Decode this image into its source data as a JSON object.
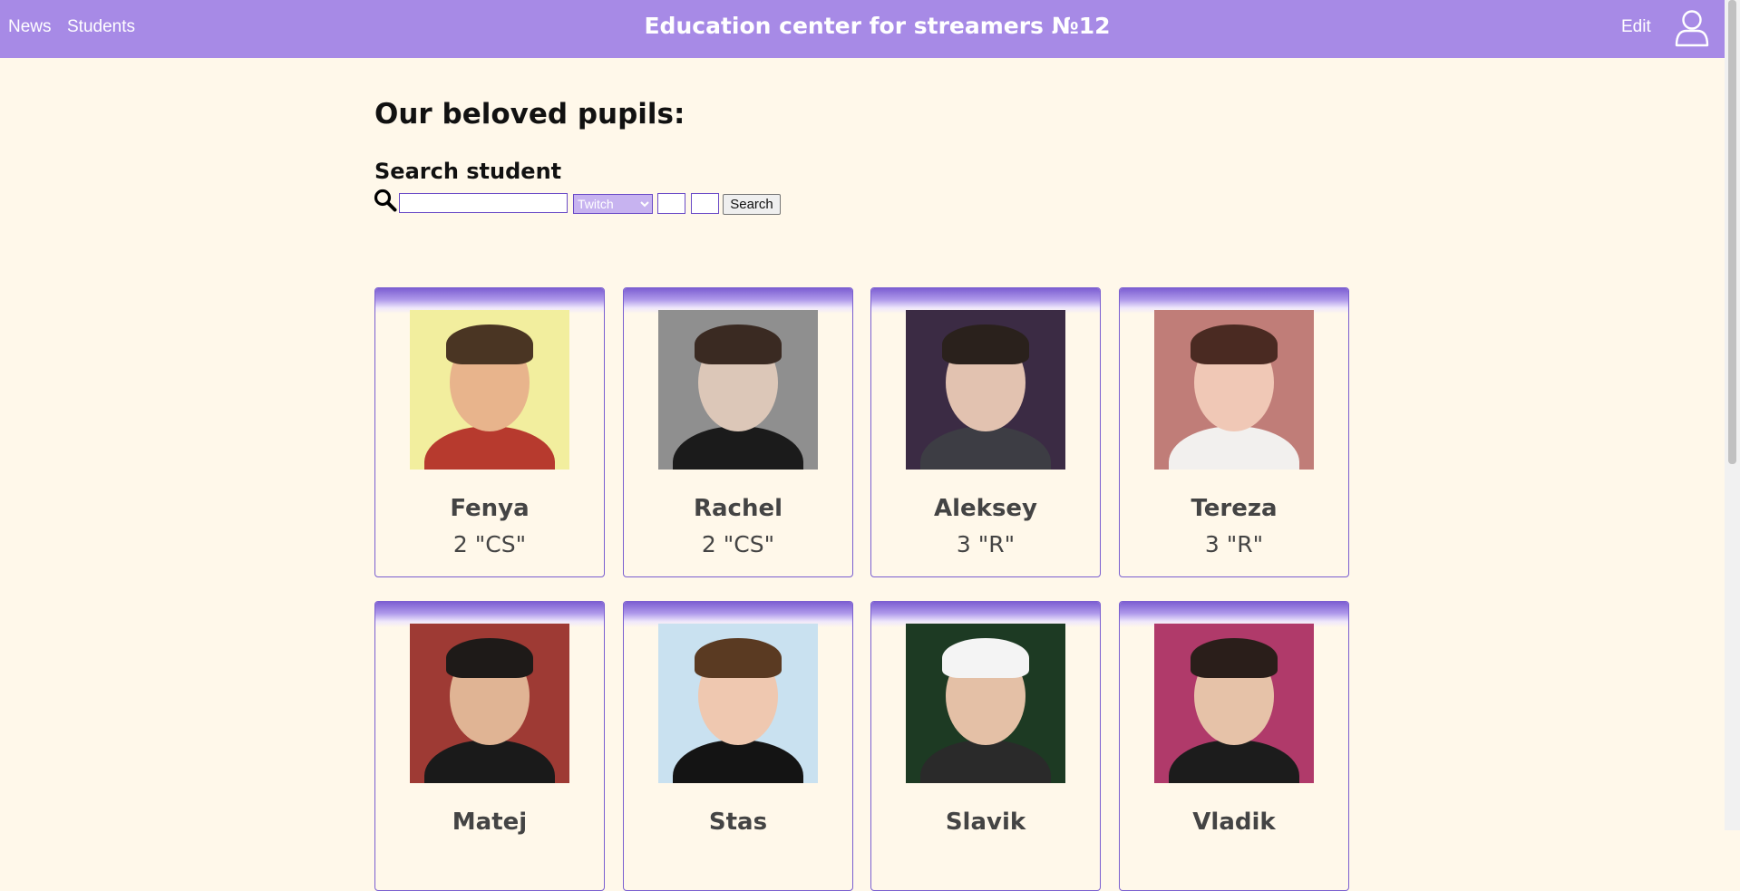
{
  "header": {
    "nav": [
      {
        "label": "News"
      },
      {
        "label": "Students"
      }
    ],
    "title": "Education center for streamers №12",
    "edit_label": "Edit",
    "user_icon": "user-icon"
  },
  "main": {
    "heading": "Our beloved pupils:",
    "search": {
      "heading": "Search student",
      "icon": "search-icon",
      "query_value": "",
      "platform_selected": "Twitch",
      "field_a_value": "",
      "field_b_value": "",
      "button_label": "Search"
    }
  },
  "students": [
    {
      "name": "Fenya",
      "grade": "2 \"CS\"",
      "photo": {
        "bg": "#f2ee9e",
        "skin": "#e8b48c",
        "hair": "#4a3523",
        "shirt": "#b73a2e"
      }
    },
    {
      "name": "Rachel",
      "grade": "2 \"CS\"",
      "photo": {
        "bg": "#8f8f8f",
        "skin": "#dcc7b8",
        "hair": "#3a2a22",
        "shirt": "#1b1b1b"
      }
    },
    {
      "name": "Aleksey",
      "grade": "3 \"R\"",
      "photo": {
        "bg": "#3b2b44",
        "skin": "#e2c2b0",
        "hair": "#2a211c",
        "shirt": "#3d3d44"
      }
    },
    {
      "name": "Tereza",
      "grade": "3 \"R\"",
      "photo": {
        "bg": "#c07d78",
        "skin": "#f0c8b6",
        "hair": "#4a2a22",
        "shirt": "#f2f0ee"
      }
    },
    {
      "name": "Matej",
      "grade": "",
      "photo": {
        "bg": "#9e3a34",
        "skin": "#e0b494",
        "hair": "#1e1a18",
        "shirt": "#1a1a1a"
      }
    },
    {
      "name": "Stas",
      "grade": "",
      "photo": {
        "bg": "#c9e1f0",
        "skin": "#efc8b0",
        "hair": "#5a3a22",
        "shirt": "#141414"
      }
    },
    {
      "name": "Slavik",
      "grade": "",
      "photo": {
        "bg": "#1d3a23",
        "skin": "#e4c0a6",
        "hair": "#f4f4f4",
        "shirt": "#2a2a2a"
      }
    },
    {
      "name": "Vladik",
      "grade": "",
      "photo": {
        "bg": "#b03a6a",
        "skin": "#e6c2a8",
        "hair": "#2a1e1a",
        "shirt": "#1c1c1c"
      }
    }
  ]
}
